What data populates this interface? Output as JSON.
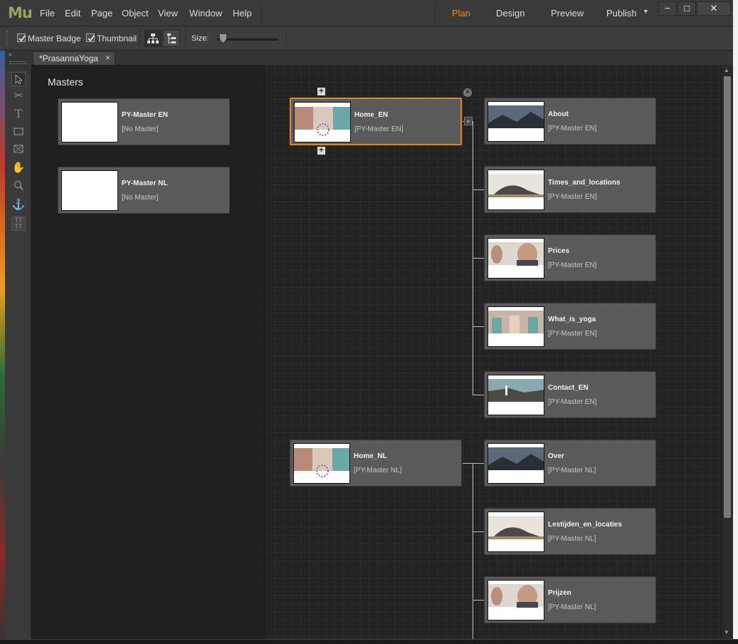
{
  "app": {
    "logo": "Mu"
  },
  "menu": [
    "File",
    "Edit",
    "Page",
    "Object",
    "View",
    "Window",
    "Help"
  ],
  "modes": [
    "Plan",
    "Design",
    "Preview",
    "Publish"
  ],
  "active_mode": "Plan",
  "window_controls": {
    "minimize": "−",
    "maximize": "□",
    "close": "✕"
  },
  "toolbar": {
    "master_badge_label": "Master Badge",
    "master_badge_checked": true,
    "thumbnail_label": "Thumbnail",
    "thumbnail_checked": true,
    "size_label": "Size:"
  },
  "document_tab": {
    "title": "*PrasannaYoga",
    "close": "×"
  },
  "masters": {
    "title": "Masters",
    "items": [
      {
        "name": "PY-Master EN",
        "master": "[No Master]"
      },
      {
        "name": "PY-Master NL",
        "master": "[No Master]"
      }
    ]
  },
  "sitemap": {
    "home_en": {
      "name": "Home_EN",
      "master": "[PY-Master EN]"
    },
    "children_en": [
      {
        "name": "About",
        "master": "[PY-Master EN]"
      },
      {
        "name": "Times_and_locations",
        "master": "[PY-Master EN]"
      },
      {
        "name": "Prices",
        "master": "[PY-Master EN]"
      },
      {
        "name": "What_is_yoga",
        "master": "[PY-Master EN]"
      },
      {
        "name": "Contact_EN",
        "master": "[PY-Master EN]"
      }
    ],
    "home_nl": {
      "name": "Home_NL",
      "master": "[PY-Master NL]"
    },
    "children_nl": [
      {
        "name": "Over",
        "master": "[PY-Master NL]"
      },
      {
        "name": "Lestijden_en_locaties",
        "master": "[PY-Master NL]"
      },
      {
        "name": "Prijzen",
        "master": "[PY-Master NL]"
      }
    ]
  },
  "colors": {
    "accent": "#f28b1d",
    "logo": "#9aa35a",
    "panel": "#3a3a3a",
    "card": "#5a5a5a"
  },
  "icons": [
    "selection-icon",
    "crop-icon",
    "text-icon",
    "rectangle-icon",
    "frame-icon",
    "hand-icon",
    "zoom-icon",
    "anchor-icon",
    "text-frame-icon"
  ]
}
